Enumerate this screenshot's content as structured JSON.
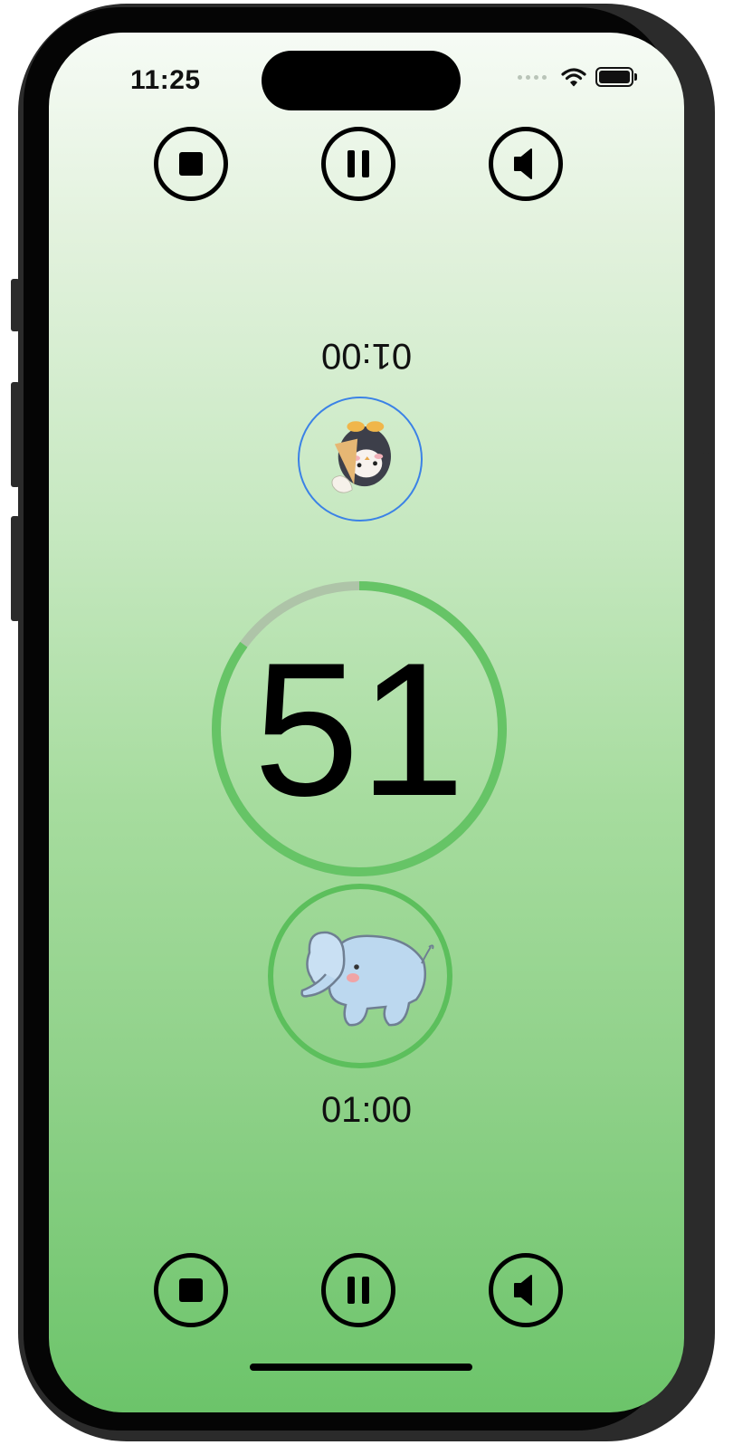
{
  "status_bar": {
    "time": "11:25"
  },
  "top_player": {
    "time": "01:00",
    "avatar_icon": "penguin-icon",
    "controls": [
      {
        "name": "stop",
        "icon": "stop-icon"
      },
      {
        "name": "pause",
        "icon": "pause-icon"
      },
      {
        "name": "sound",
        "icon": "speaker-icon"
      }
    ]
  },
  "countdown": {
    "value": "51",
    "progress": 0.85
  },
  "bottom_player": {
    "time": "01:00",
    "avatar_icon": "elephant-icon",
    "controls": [
      {
        "name": "stop",
        "icon": "stop-icon"
      },
      {
        "name": "pause",
        "icon": "pause-icon"
      },
      {
        "name": "sound",
        "icon": "speaker-icon"
      }
    ]
  },
  "colors": {
    "ring_active": "#66c466",
    "ring_track": "#aec4a8",
    "top_avatar_border": "#3b82e6",
    "bottom_avatar_border": "#5cbf5c"
  }
}
